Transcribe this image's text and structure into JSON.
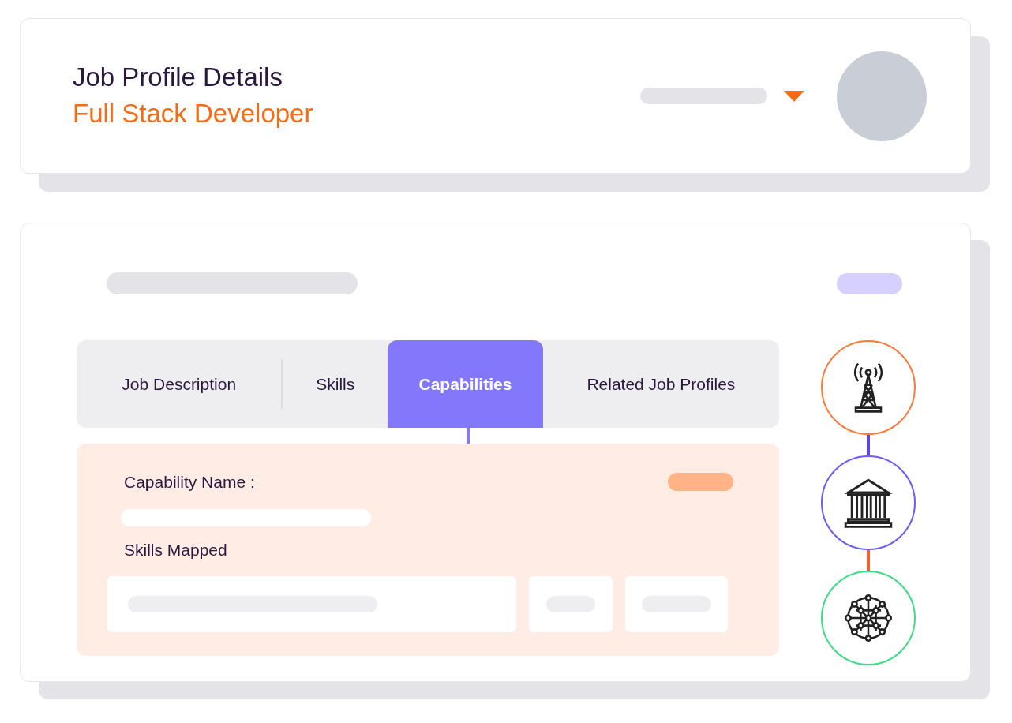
{
  "header": {
    "title": "Job Profile Details",
    "subtitle": "Full Stack Developer"
  },
  "tabs": [
    {
      "label": "Job Description",
      "selected": false
    },
    {
      "label": "Skills",
      "selected": false
    },
    {
      "label": "Capabilities",
      "selected": true
    },
    {
      "label": "Related Job Profiles",
      "selected": false
    }
  ],
  "panel": {
    "name_label": "Capability Name :",
    "skills_label": "Skills Mapped"
  },
  "steps": [
    {
      "kind": "tower",
      "color": "#f97a3a"
    },
    {
      "kind": "building",
      "color": "#6d5cf6"
    },
    {
      "kind": "network",
      "color": "#3ddc84"
    }
  ]
}
